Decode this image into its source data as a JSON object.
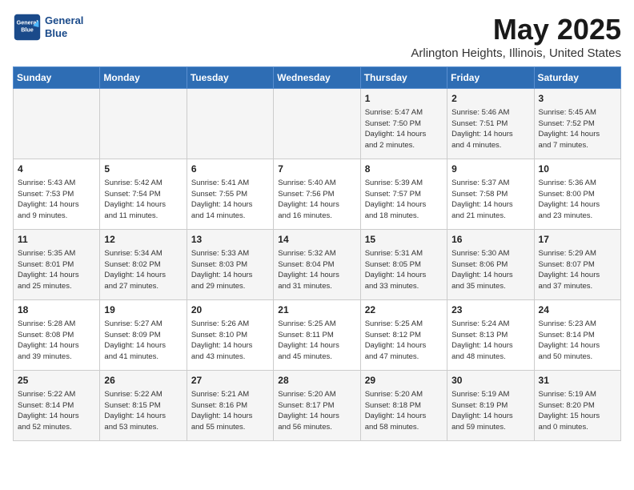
{
  "header": {
    "logo_line1": "General",
    "logo_line2": "Blue",
    "month": "May 2025",
    "location": "Arlington Heights, Illinois, United States"
  },
  "days_of_week": [
    "Sunday",
    "Monday",
    "Tuesday",
    "Wednesday",
    "Thursday",
    "Friday",
    "Saturday"
  ],
  "weeks": [
    [
      {
        "day": "",
        "info": ""
      },
      {
        "day": "",
        "info": ""
      },
      {
        "day": "",
        "info": ""
      },
      {
        "day": "",
        "info": ""
      },
      {
        "day": "1",
        "info": "Sunrise: 5:47 AM\nSunset: 7:50 PM\nDaylight: 14 hours\nand 2 minutes."
      },
      {
        "day": "2",
        "info": "Sunrise: 5:46 AM\nSunset: 7:51 PM\nDaylight: 14 hours\nand 4 minutes."
      },
      {
        "day": "3",
        "info": "Sunrise: 5:45 AM\nSunset: 7:52 PM\nDaylight: 14 hours\nand 7 minutes."
      }
    ],
    [
      {
        "day": "4",
        "info": "Sunrise: 5:43 AM\nSunset: 7:53 PM\nDaylight: 14 hours\nand 9 minutes."
      },
      {
        "day": "5",
        "info": "Sunrise: 5:42 AM\nSunset: 7:54 PM\nDaylight: 14 hours\nand 11 minutes."
      },
      {
        "day": "6",
        "info": "Sunrise: 5:41 AM\nSunset: 7:55 PM\nDaylight: 14 hours\nand 14 minutes."
      },
      {
        "day": "7",
        "info": "Sunrise: 5:40 AM\nSunset: 7:56 PM\nDaylight: 14 hours\nand 16 minutes."
      },
      {
        "day": "8",
        "info": "Sunrise: 5:39 AM\nSunset: 7:57 PM\nDaylight: 14 hours\nand 18 minutes."
      },
      {
        "day": "9",
        "info": "Sunrise: 5:37 AM\nSunset: 7:58 PM\nDaylight: 14 hours\nand 21 minutes."
      },
      {
        "day": "10",
        "info": "Sunrise: 5:36 AM\nSunset: 8:00 PM\nDaylight: 14 hours\nand 23 minutes."
      }
    ],
    [
      {
        "day": "11",
        "info": "Sunrise: 5:35 AM\nSunset: 8:01 PM\nDaylight: 14 hours\nand 25 minutes."
      },
      {
        "day": "12",
        "info": "Sunrise: 5:34 AM\nSunset: 8:02 PM\nDaylight: 14 hours\nand 27 minutes."
      },
      {
        "day": "13",
        "info": "Sunrise: 5:33 AM\nSunset: 8:03 PM\nDaylight: 14 hours\nand 29 minutes."
      },
      {
        "day": "14",
        "info": "Sunrise: 5:32 AM\nSunset: 8:04 PM\nDaylight: 14 hours\nand 31 minutes."
      },
      {
        "day": "15",
        "info": "Sunrise: 5:31 AM\nSunset: 8:05 PM\nDaylight: 14 hours\nand 33 minutes."
      },
      {
        "day": "16",
        "info": "Sunrise: 5:30 AM\nSunset: 8:06 PM\nDaylight: 14 hours\nand 35 minutes."
      },
      {
        "day": "17",
        "info": "Sunrise: 5:29 AM\nSunset: 8:07 PM\nDaylight: 14 hours\nand 37 minutes."
      }
    ],
    [
      {
        "day": "18",
        "info": "Sunrise: 5:28 AM\nSunset: 8:08 PM\nDaylight: 14 hours\nand 39 minutes."
      },
      {
        "day": "19",
        "info": "Sunrise: 5:27 AM\nSunset: 8:09 PM\nDaylight: 14 hours\nand 41 minutes."
      },
      {
        "day": "20",
        "info": "Sunrise: 5:26 AM\nSunset: 8:10 PM\nDaylight: 14 hours\nand 43 minutes."
      },
      {
        "day": "21",
        "info": "Sunrise: 5:25 AM\nSunset: 8:11 PM\nDaylight: 14 hours\nand 45 minutes."
      },
      {
        "day": "22",
        "info": "Sunrise: 5:25 AM\nSunset: 8:12 PM\nDaylight: 14 hours\nand 47 minutes."
      },
      {
        "day": "23",
        "info": "Sunrise: 5:24 AM\nSunset: 8:13 PM\nDaylight: 14 hours\nand 48 minutes."
      },
      {
        "day": "24",
        "info": "Sunrise: 5:23 AM\nSunset: 8:14 PM\nDaylight: 14 hours\nand 50 minutes."
      }
    ],
    [
      {
        "day": "25",
        "info": "Sunrise: 5:22 AM\nSunset: 8:14 PM\nDaylight: 14 hours\nand 52 minutes."
      },
      {
        "day": "26",
        "info": "Sunrise: 5:22 AM\nSunset: 8:15 PM\nDaylight: 14 hours\nand 53 minutes."
      },
      {
        "day": "27",
        "info": "Sunrise: 5:21 AM\nSunset: 8:16 PM\nDaylight: 14 hours\nand 55 minutes."
      },
      {
        "day": "28",
        "info": "Sunrise: 5:20 AM\nSunset: 8:17 PM\nDaylight: 14 hours\nand 56 minutes."
      },
      {
        "day": "29",
        "info": "Sunrise: 5:20 AM\nSunset: 8:18 PM\nDaylight: 14 hours\nand 58 minutes."
      },
      {
        "day": "30",
        "info": "Sunrise: 5:19 AM\nSunset: 8:19 PM\nDaylight: 14 hours\nand 59 minutes."
      },
      {
        "day": "31",
        "info": "Sunrise: 5:19 AM\nSunset: 8:20 PM\nDaylight: 15 hours\nand 0 minutes."
      }
    ]
  ]
}
